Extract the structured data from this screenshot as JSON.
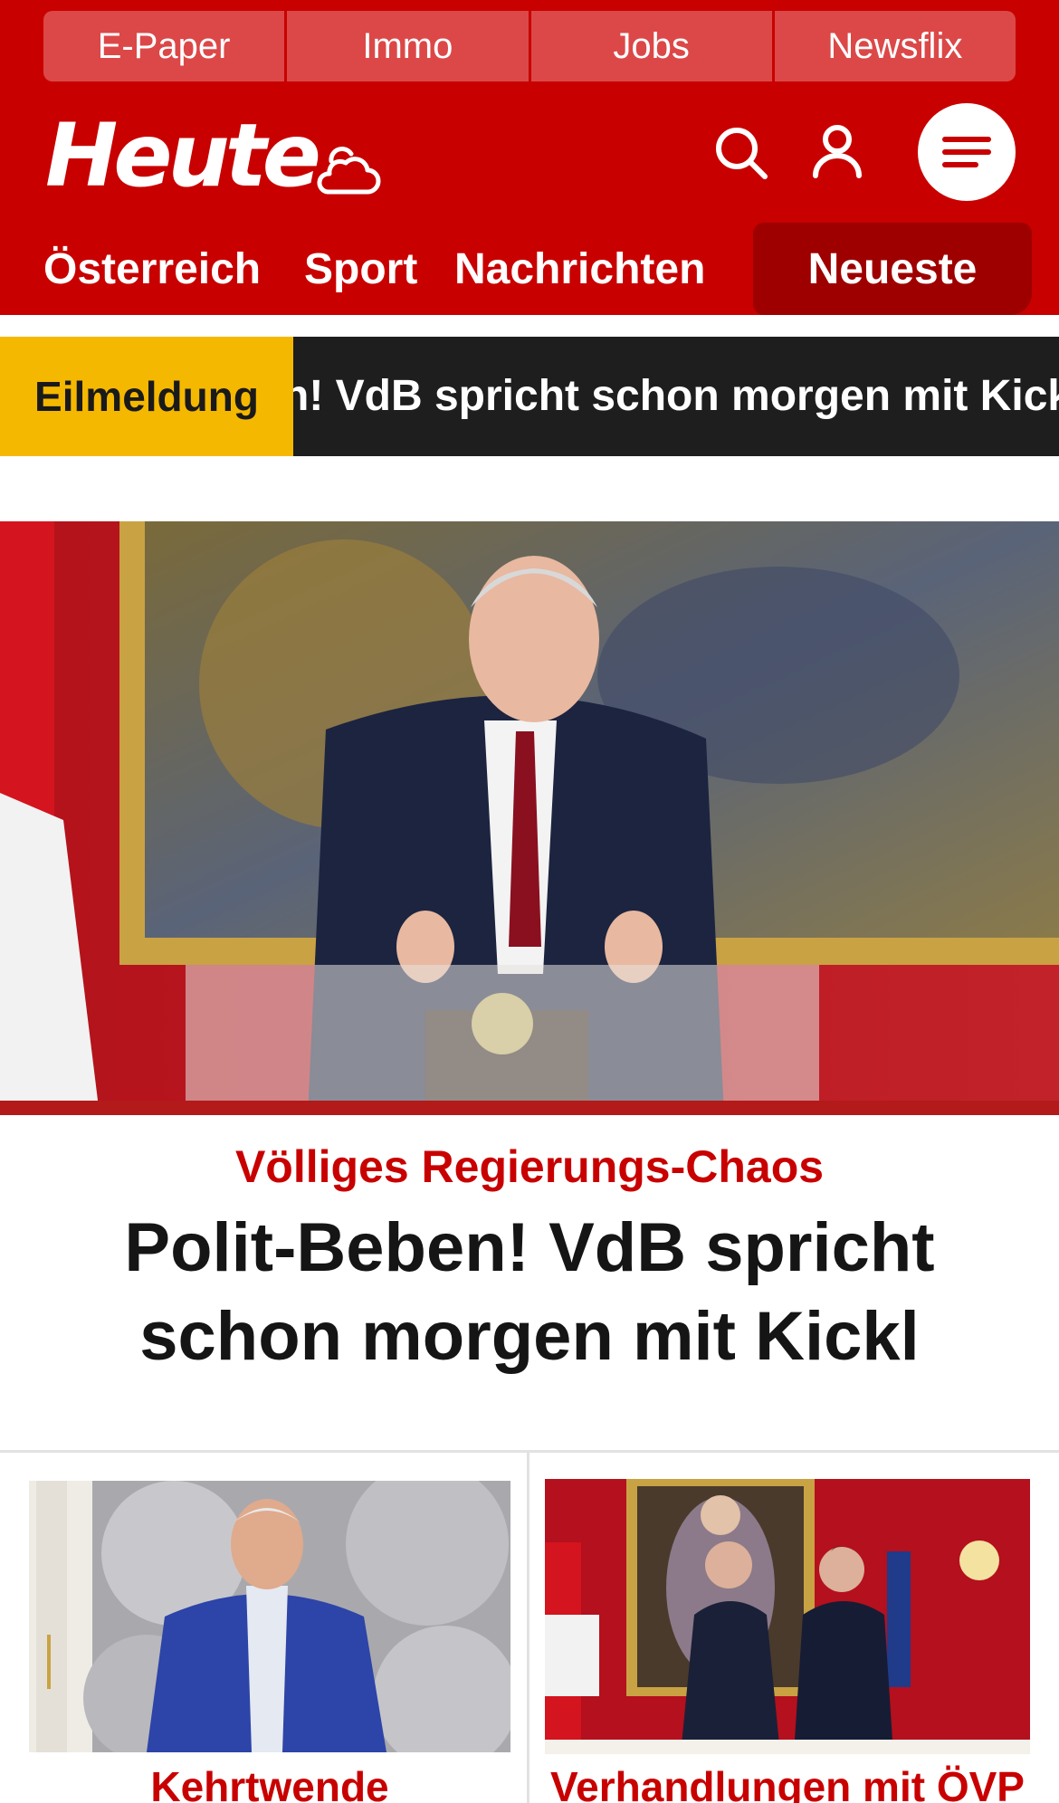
{
  "topbar": {
    "items": [
      {
        "label": "E-Paper"
      },
      {
        "label": "Immo"
      },
      {
        "label": "Jobs"
      },
      {
        "label": "Newsflix"
      }
    ]
  },
  "header": {
    "logo": "Heute",
    "icons": [
      "weather-cloud-sun-icon",
      "search-icon",
      "user-icon",
      "menu-icon"
    ]
  },
  "nav": {
    "items": [
      {
        "label": "Österreich"
      },
      {
        "label": "Sport"
      },
      {
        "label": "Nachrichten"
      }
    ],
    "highlight": "Neueste"
  },
  "breaking": {
    "label": "Eilmeldung",
    "text": "n! VdB spricht schon morgen mit Kickl"
  },
  "hero": {
    "kicker": "Völliges Regierungs-Chaos",
    "title": "Polit-Beben! VdB spricht schon morgen mit Kickl"
  },
  "cards": [
    {
      "kicker": "Kehrtwende"
    },
    {
      "kicker": "Verhandlungen mit ÖVP"
    }
  ],
  "colors": {
    "brand_red": "#c80000",
    "nav_active": "#9e0000",
    "breaking_label": "#f5b800",
    "breaking_bg": "#1e1e1e"
  }
}
